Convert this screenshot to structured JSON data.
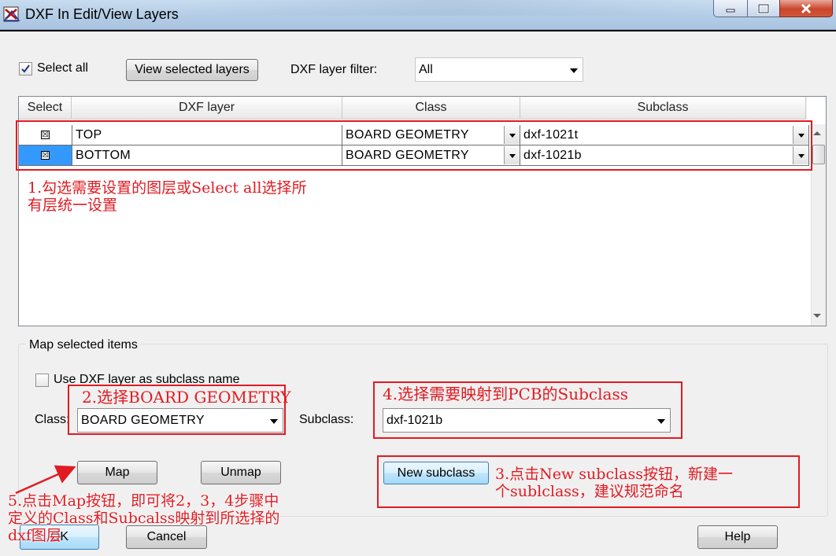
{
  "window": {
    "title": "DXF In Edit/View Layers"
  },
  "top": {
    "select_all_label": "Select all",
    "select_all_checked": true,
    "view_selected_label": "View selected layers",
    "filter_label": "DXF layer filter:",
    "filter_value": "All"
  },
  "grid": {
    "columns": [
      "Select",
      "DXF layer",
      "Class",
      "Subclass"
    ],
    "rows": [
      {
        "selected_mark": "☒",
        "layer": "TOP",
        "class": "BOARD GEOMETRY",
        "subclass": "dxf-1021t",
        "highlighted": false
      },
      {
        "selected_mark": "☒",
        "layer": "BOTTOM",
        "class": "BOARD GEOMETRY",
        "subclass": "dxf-1021b",
        "highlighted": true
      }
    ]
  },
  "map": {
    "group_title": "Map selected items",
    "use_dxf_label": "Use DXF layer as subclass name",
    "use_dxf_checked": false,
    "class_label": "Class:",
    "class_value": "BOARD GEOMETRY",
    "subclass_label": "Subclass:",
    "subclass_value": "dxf-1021b",
    "map_label": "Map",
    "unmap_label": "Unmap",
    "new_subclass_label": "New subclass"
  },
  "footer": {
    "ok_label": "OK",
    "cancel_label": "Cancel",
    "help_label": "Help"
  },
  "annotations": {
    "step1": "1.勾选需要设置的图层或Select all选择所\n有层统一设置",
    "step2": "2.选择BOARD GEOMETRY",
    "step3": "3.点击New subclass按钮，新建一\n个sublclass，建议规范命名",
    "step4": "4.选择需要映射到PCB的Subclass",
    "step5": "5.点击Map按钮，即可将2，3，4步骤中\n定义的Class和Subcalss映射到所选择的\ndxf图层"
  },
  "colors": {
    "annotation_red": "#e11b22",
    "row_highlight": "#3399ff",
    "titlebar": "#b7cfe8"
  },
  "icons": {
    "app": "dxf-app-icon",
    "minimize": "minimize-icon",
    "maximize": "maximize-icon",
    "close": "close-icon"
  }
}
